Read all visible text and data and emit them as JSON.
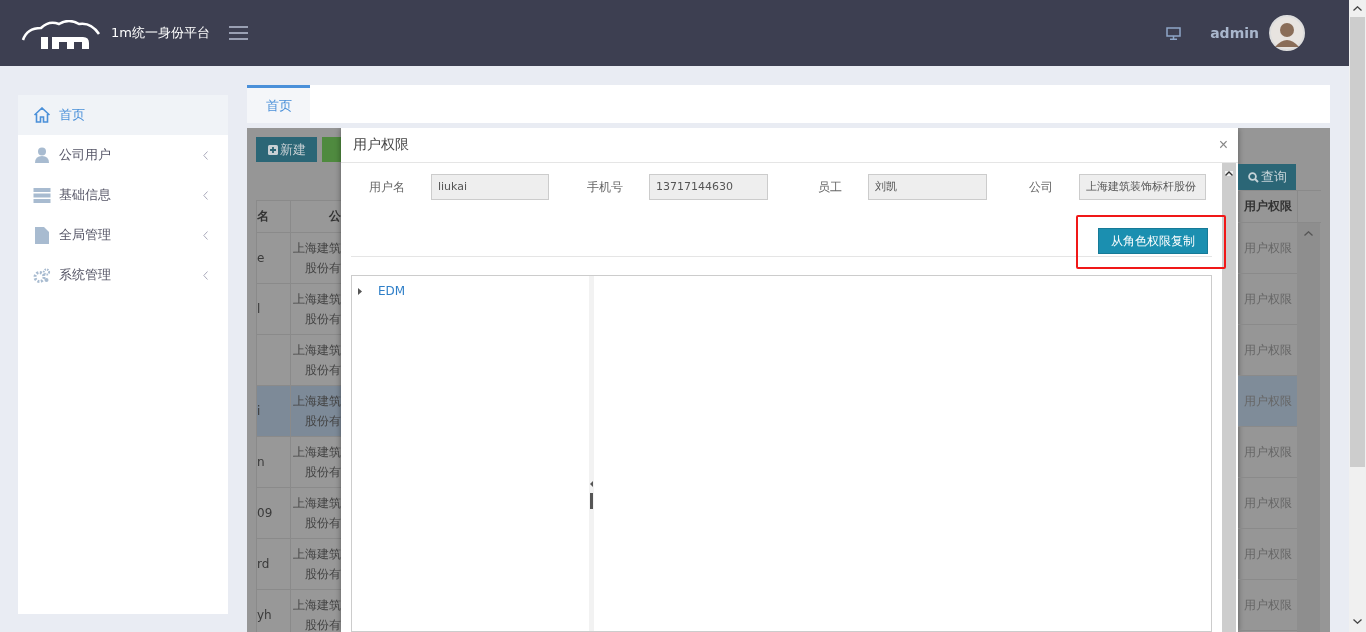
{
  "header": {
    "title": "1m统一身份平台",
    "user": "admin"
  },
  "sidebar": {
    "items": [
      {
        "label": "首页",
        "kind": "home",
        "selected": true,
        "expandable": false
      },
      {
        "label": "公司用户",
        "kind": "user",
        "selected": false,
        "expandable": true
      },
      {
        "label": "基础信息",
        "kind": "server",
        "selected": false,
        "expandable": true
      },
      {
        "label": "全局管理",
        "kind": "file",
        "selected": false,
        "expandable": true
      },
      {
        "label": "系统管理",
        "kind": "gears",
        "selected": false,
        "expandable": true
      }
    ]
  },
  "tabs": [
    {
      "label": "首页",
      "selected": true
    }
  ],
  "toolbar": {
    "new_button": "新建",
    "search_button": "查询"
  },
  "table": {
    "columns": [
      "名",
      "公",
      "用户权限"
    ],
    "rows": [
      {
        "column_1": "e",
        "column_2": [
          "上海建筑",
          "股份有"
        ],
        "permission": "用户权限",
        "selected": false
      },
      {
        "column_1": "l",
        "column_2": [
          "上海建筑",
          "股份有"
        ],
        "permission": "用户权限",
        "selected": false
      },
      {
        "column_1": "",
        "column_2": [
          "上海建筑",
          "股份有"
        ],
        "permission": "用户权限",
        "selected": false
      },
      {
        "column_1": "i",
        "column_2": [
          "上海建筑",
          "股份有"
        ],
        "permission": "用户权限",
        "selected": true
      },
      {
        "column_1": "n",
        "column_2": [
          "上海建筑",
          "股份有"
        ],
        "permission": "用户权限",
        "selected": false
      },
      {
        "column_1": "09",
        "column_2": [
          "上海建筑",
          "股份有"
        ],
        "permission": "用户权限",
        "selected": false
      },
      {
        "column_1": "rd",
        "column_2": [
          "上海建筑",
          "股份有"
        ],
        "permission": "用户权限",
        "selected": false
      },
      {
        "column_1": "yh",
        "column_2": [
          "上海建筑",
          "股份有"
        ],
        "permission": "用户权限",
        "selected": false
      }
    ]
  },
  "modal": {
    "title": "用户权限",
    "close": "×",
    "fields": [
      {
        "label": "用户名",
        "value": "liukai"
      },
      {
        "label": "手机号",
        "value": "13717144630"
      },
      {
        "label": "员工",
        "value": "刘凯"
      },
      {
        "label": "公司",
        "value": "上海建筑装饰标杆股份"
      }
    ],
    "copy_button": "从角色权限复制",
    "highlighted": true,
    "tree": [
      {
        "label": "EDM",
        "expanded": false
      }
    ]
  }
}
